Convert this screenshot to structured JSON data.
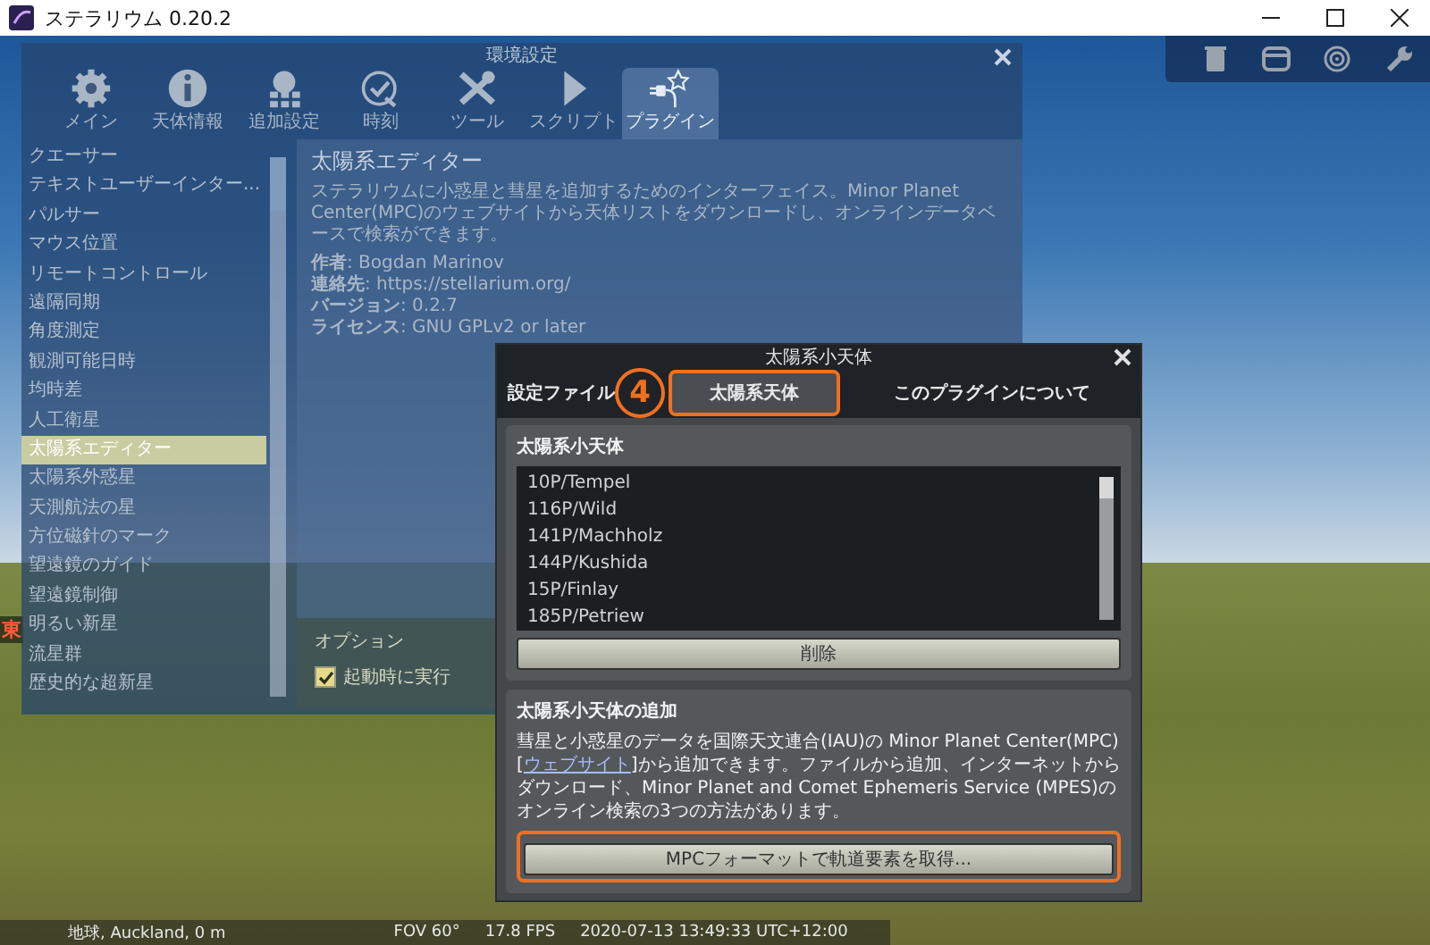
{
  "window": {
    "title": "ステラリウム 0.20.2"
  },
  "compass": [
    {
      "label": "東"
    }
  ],
  "settings_window": {
    "title": "環境設定",
    "tabs": [
      {
        "label": "メイン",
        "kind": "gear",
        "selected": false
      },
      {
        "label": "天体情報",
        "kind": "info",
        "selected": false
      },
      {
        "label": "追加設定",
        "kind": "grid",
        "selected": false
      },
      {
        "label": "時刻",
        "kind": "clock",
        "selected": false
      },
      {
        "label": "ツール",
        "kind": "tools",
        "selected": false
      },
      {
        "label": "スクリプト",
        "kind": "play",
        "selected": false
      },
      {
        "label": "プラグイン",
        "kind": "plug",
        "selected": true
      }
    ]
  },
  "plugins": {
    "items": [
      {
        "label": "クエーサー",
        "selected": false
      },
      {
        "label": "テキストユーザーインター...",
        "selected": false
      },
      {
        "label": "パルサー",
        "selected": false
      },
      {
        "label": "マウス位置",
        "selected": false
      },
      {
        "label": "リモートコントロール",
        "selected": false
      },
      {
        "label": "遠隔同期",
        "selected": false
      },
      {
        "label": "角度測定",
        "selected": false
      },
      {
        "label": "観測可能日時",
        "selected": false
      },
      {
        "label": "均時差",
        "selected": false
      },
      {
        "label": "人工衛星",
        "selected": false
      },
      {
        "label": "太陽系エディター",
        "selected": true
      },
      {
        "label": "太陽系外惑星",
        "selected": false
      },
      {
        "label": "天測航法の星",
        "selected": false
      },
      {
        "label": "方位磁針のマーク",
        "selected": false
      },
      {
        "label": "望遠鏡のガイド",
        "selected": false
      },
      {
        "label": "望遠鏡制御",
        "selected": false
      },
      {
        "label": "明るい新星",
        "selected": false
      },
      {
        "label": "流星群",
        "selected": false
      },
      {
        "label": "歴史的な超新星",
        "selected": false
      }
    ],
    "title": "太陽系エディター",
    "description": "ステラリウムに小惑星と彗星を追加するためのインターフェイス。Minor Planet Center(MPC)のウェブサイトから天体リストをダウンロードし、オンラインデータベースで検索ができます。",
    "meta": [
      "**作者**: Bogdan Marinov",
      "**連絡先**: https://stellarium.org/",
      "**バージョン**: 0.2.7",
      "**ライセンス**: GNU GPLv2 or later"
    ],
    "options_title": "オプション",
    "autostart": {
      "label": "起動時に実行",
      "checked": true
    }
  },
  "dialog": {
    "title": "太陽系小天体",
    "tabs": [
      {
        "label": "設定ファイル",
        "selected": false
      },
      {
        "label": "太陽系天体",
        "selected": true
      },
      {
        "label": "このプラグインについて",
        "selected": false
      }
    ],
    "step_badge": "4",
    "objects_group": {
      "title": "太陽系小天体",
      "items": [
        "10P/Tempel",
        "116P/Wild",
        "141P/Machholz",
        "144P/Kushida",
        "15P/Finlay",
        "185P/Petriew"
      ],
      "button": "削除"
    },
    "add_group": {
      "title": "太陽系小天体の追加",
      "text_before": "彗星と小惑星のデータを国際天文連合(IAU)の Minor Planet Center(MPC) [",
      "link": "ウェブサイト",
      "text_after": "]から追加できます。ファイルから追加、インターネットからダウンロード、Minor Planet and Comet Ephemeris Service (MPES)のオンライン検索の3つの方法があります。",
      "button": "MPCフォーマットで軌道要素を取得..."
    }
  },
  "status_bar": {
    "location": "地球, Auckland, 0 m",
    "fov": "FOV 60°",
    "fps": "17.8 FPS",
    "datetime": "2020-07-13 13:49:33 UTC+12:00"
  }
}
